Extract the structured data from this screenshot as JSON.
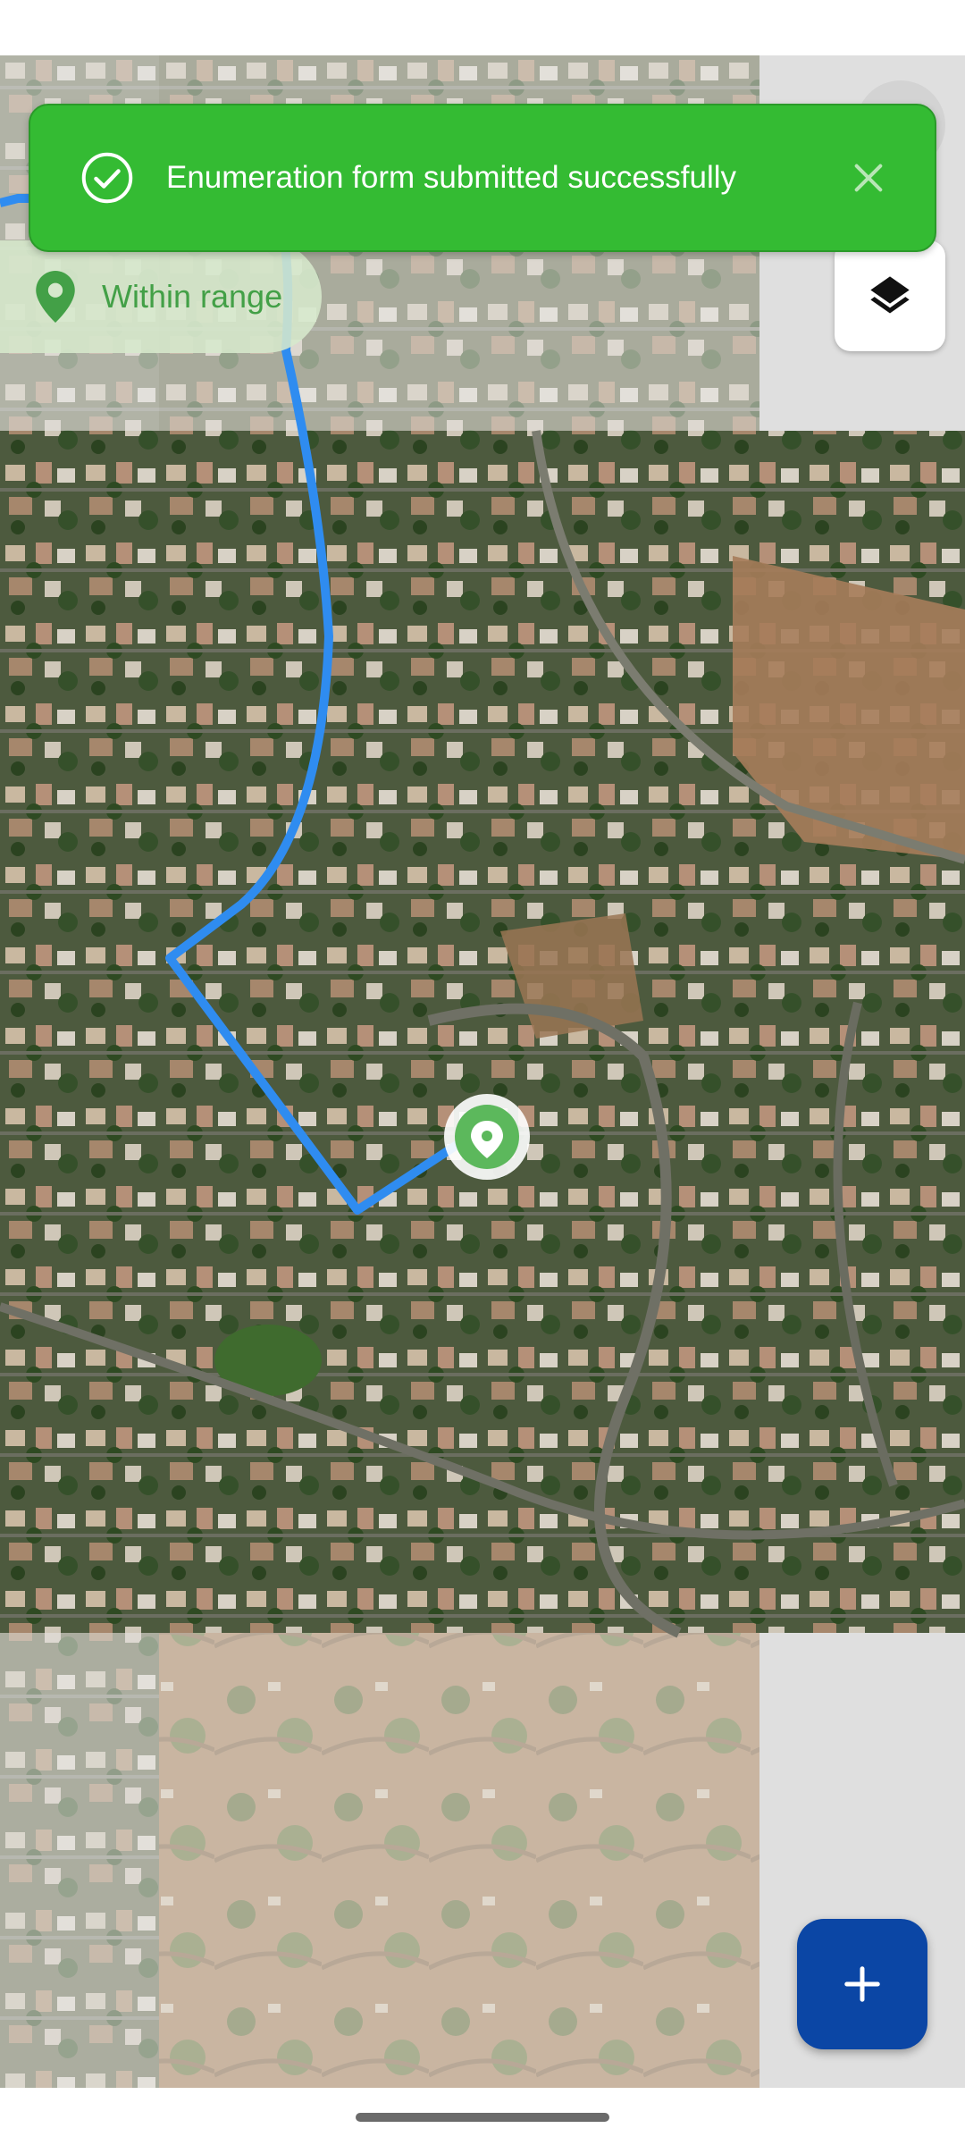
{
  "toast": {
    "message": "Enumeration form submitted successfully",
    "icon": "check-circle-icon",
    "close_icon": "close-icon",
    "background_color": "#34bb33"
  },
  "range_chip": {
    "label": "Within range",
    "icon": "location-pin-icon",
    "text_color": "#43a047"
  },
  "map": {
    "imagery": "satellite",
    "route_color": "#2f8cf0",
    "marker_icon": "location-pin-icon",
    "marker_color": "#5cb85c"
  },
  "controls": {
    "layers_icon": "layers-icon",
    "fab_icon": "plus-icon",
    "fab_color": "#0b46a5"
  }
}
